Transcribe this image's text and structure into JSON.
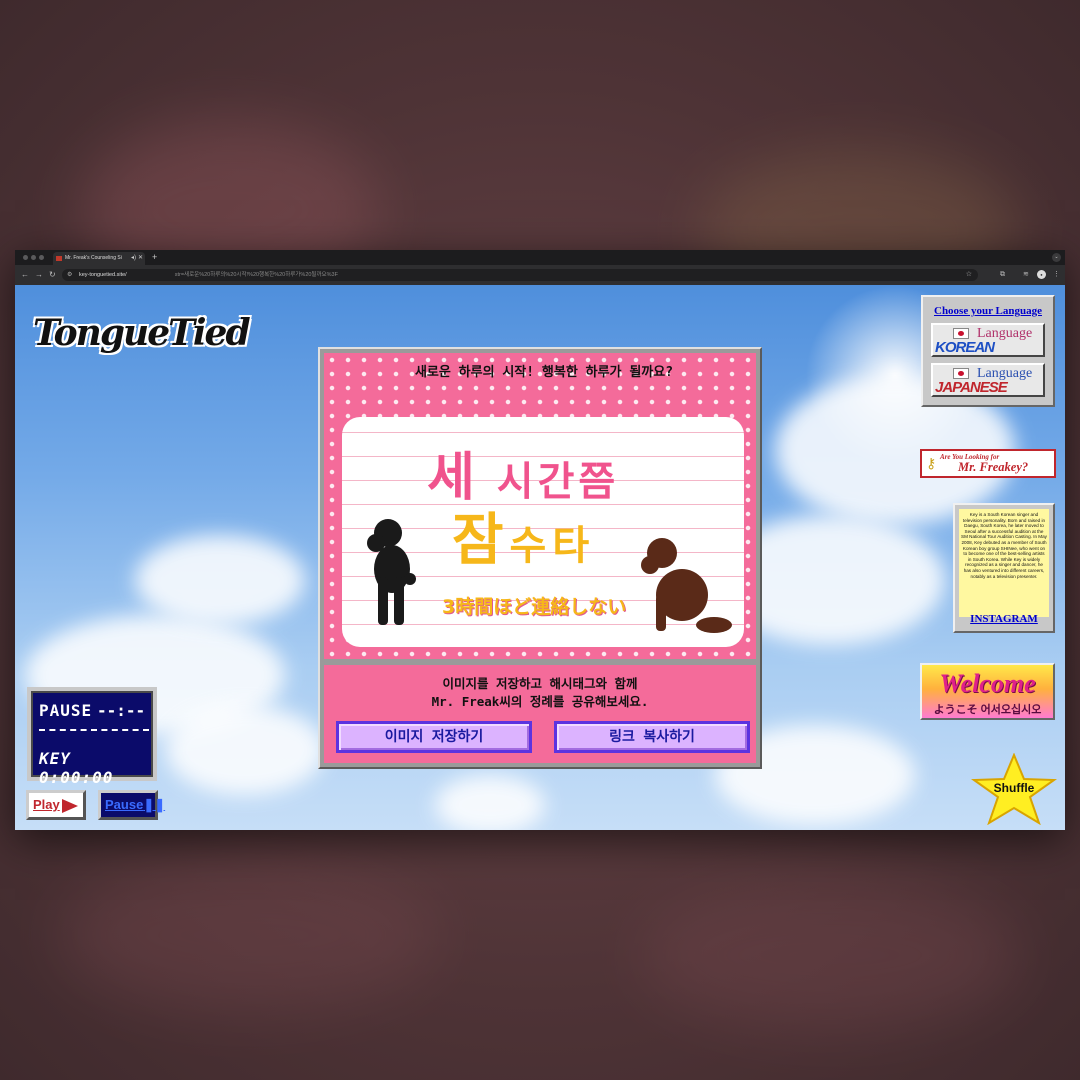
{
  "browser": {
    "tab_title": "Mr. Freak's Counseling Si",
    "url_host": "key-tonguetied.site/",
    "url_query": "str=새로운%20하루의%20시작!%20행복한%20하루가%20될까요%3F"
  },
  "logo": {
    "text": "TongueTied"
  },
  "panel": {
    "question": "새로운 하루의 시작! 행복한 하루가 될까요?",
    "card_line1_a": "세",
    "card_line1_b": "시간쯤",
    "card_line2_a": "잠",
    "card_line2_b": "수타",
    "card_line3": "3時間ほど連絡しない",
    "share_text_line1": "이미지를 저장하고 해시태그와 함께",
    "share_text_line2": "Mr. Freak씨의 정례를 공유해보세요.",
    "save_button": "이미지 저장하기",
    "copy_button": "링크 복사하기"
  },
  "language": {
    "title": "Choose your Language",
    "korean_label": "Language",
    "korean_name": "KOREAN",
    "japanese_label": "Language",
    "japanese_name": "JAPANESE"
  },
  "freakey": {
    "line1": "Are You Looking for",
    "line2": "Mr. Freakey?"
  },
  "bio": {
    "text": "Key is a South Korean singer and television personality. Born and raised in Daegu, South Korea, he later moved to Seoul after a successful audition at the SM National Tour Audition Casting. In May 2008, Key debuted as a member of South Korean boy group SHINee, who went on to become one of the best-selling artists in South Korea. While Key is widely recognized as a singer and dancer, he has also ventured into different careers, notably as a television presenter.",
    "instagram": "INSTAGRAM"
  },
  "welcome": {
    "title": "Welcome",
    "subtitle": "ようこそ 어서오십시오"
  },
  "shuffle": {
    "label": "Shuffle"
  },
  "player": {
    "status": "PAUSE",
    "time_a": "--:--",
    "track": "KEY 0:00:00",
    "play_label": "Play",
    "pause_label": "Pause"
  },
  "colors": {
    "pink": "#f46b9a",
    "purple_button": "#dcb3ff",
    "navy": "#0b0b6a"
  }
}
